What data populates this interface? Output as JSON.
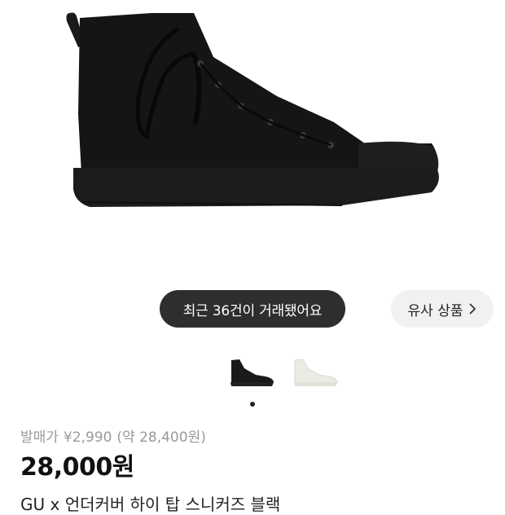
{
  "hero": {
    "shoe_color": "#151515",
    "sole_color": "#1c1c1c"
  },
  "trade_badge": {
    "label": "최근 36건이 거래됐어요"
  },
  "similar": {
    "label": "유사 상품",
    "icon": "chevron-right-icon"
  },
  "thumbnails": [
    {
      "color": "#1a1a1a",
      "selected": true
    },
    {
      "color": "#ecebe3",
      "selected": false
    }
  ],
  "pagination": {
    "current": 1,
    "total": 1
  },
  "product": {
    "release_label": "발매가",
    "release_price": "¥2,990",
    "release_converted": "(약 28,400원)",
    "price": "28,000원",
    "title": "GU x 언더커버 하이 탑 스니커즈 블랙"
  },
  "colors": {
    "pill_bg": "#2e2e2e",
    "muted_text": "#9a9a9a",
    "similar_bg": "#f1f1f1"
  }
}
